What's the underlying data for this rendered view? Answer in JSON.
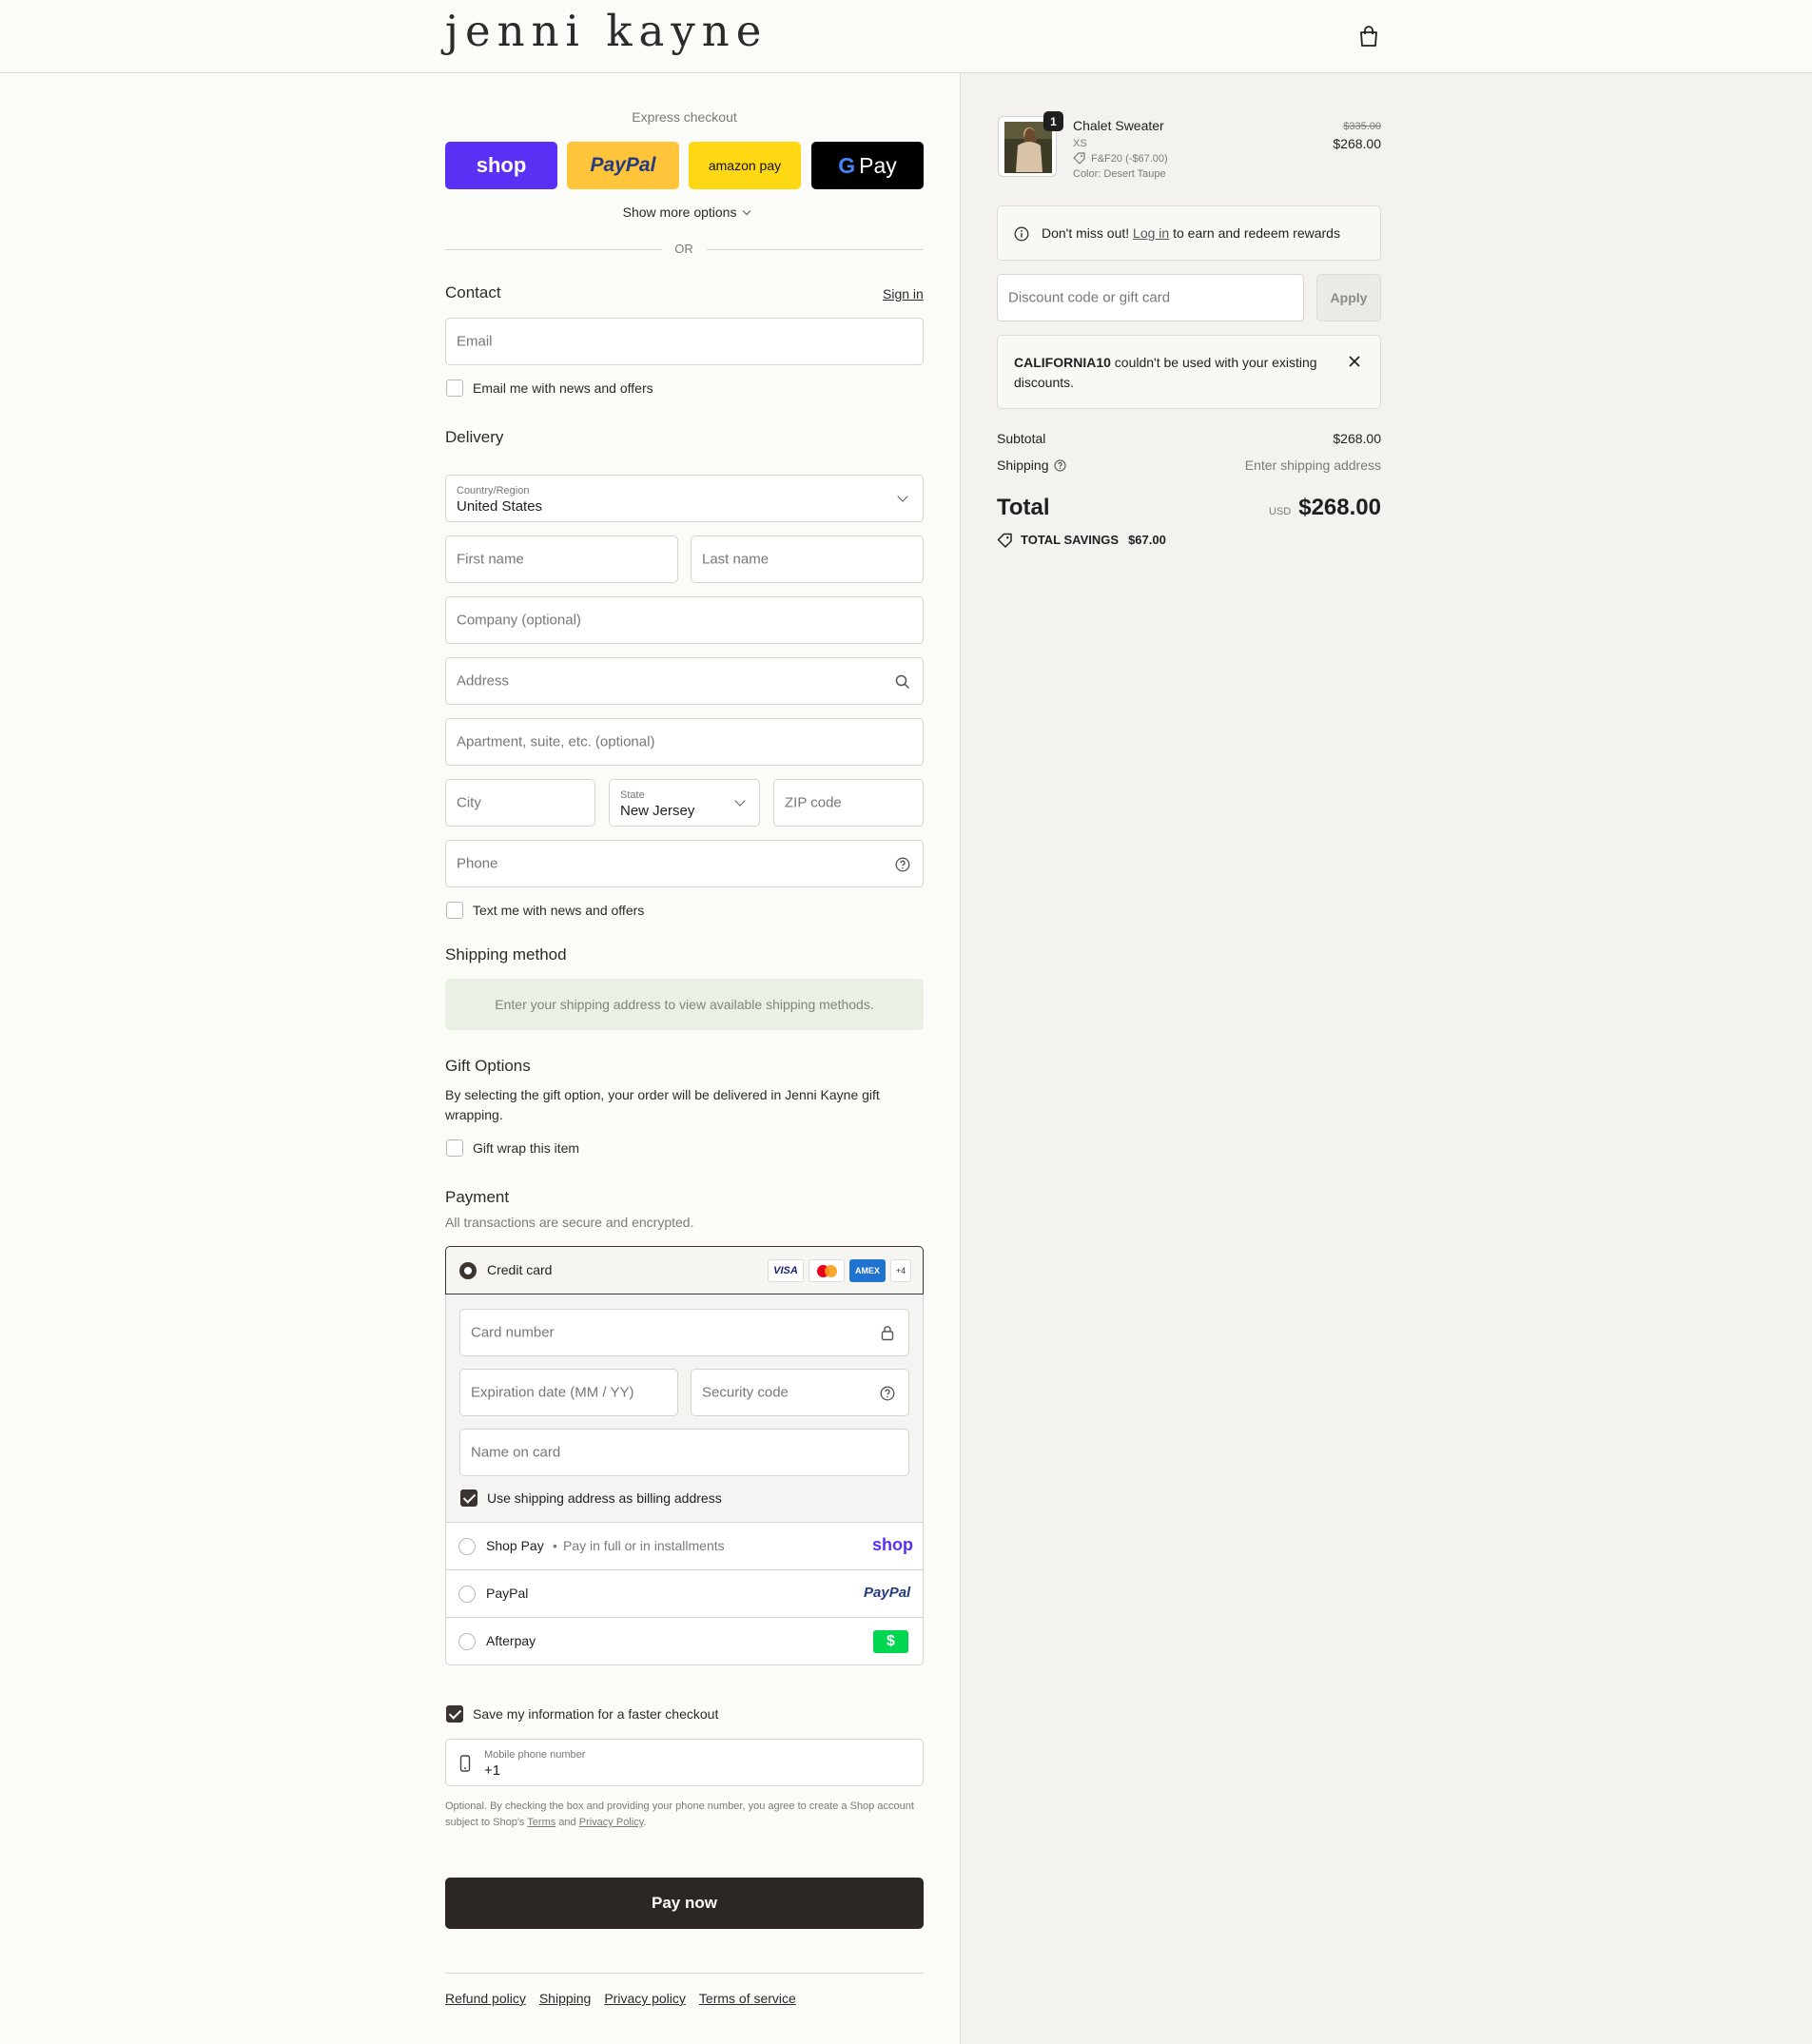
{
  "header": {
    "logo": "jenni kayne"
  },
  "express": {
    "title": "Express checkout",
    "shop_label": "shop",
    "paypal_label": "PayPal",
    "amazon_label": "amazon pay",
    "gpay_label": "Pay",
    "show_more": "Show more options",
    "or": "OR"
  },
  "contact": {
    "title": "Contact",
    "sign_in": "Sign in",
    "email_placeholder": "Email",
    "news_label": "Email me with news and offers"
  },
  "delivery": {
    "title": "Delivery",
    "country_label": "Country/Region",
    "country_value": "United States",
    "first_name": "First name",
    "last_name": "Last name",
    "company": "Company (optional)",
    "address": "Address",
    "apartment": "Apartment, suite, etc. (optional)",
    "city": "City",
    "state_label": "State",
    "state_value": "New Jersey",
    "zip": "ZIP code",
    "phone": "Phone",
    "text_label": "Text me with news and offers"
  },
  "shipping_method": {
    "title": "Shipping method",
    "message": "Enter your shipping address to view available shipping methods."
  },
  "gift": {
    "title": "Gift Options",
    "description": "By selecting the gift option, your order will be delivered in Jenni Kayne gift wrapping.",
    "wrap_label": "Gift wrap this item"
  },
  "payment": {
    "title": "Payment",
    "subtitle": "All transactions are secure and encrypted.",
    "credit_card": "Credit card",
    "card_brands": [
      "VISA",
      "AMEX",
      "+4"
    ],
    "card_number": "Card number",
    "expiration": "Expiration date (MM / YY)",
    "security": "Security code",
    "name_on_card": "Name on card",
    "billing_label": "Use shipping address as billing address",
    "shop_pay": "Shop Pay",
    "shop_pay_sub": "Pay in full or in installments",
    "shop_logo": "shop",
    "paypal": "PayPal",
    "paypal_logo": "PayPal",
    "afterpay": "Afterpay",
    "afterpay_logo": "$"
  },
  "save_info": {
    "label": "Save my information for a faster checkout",
    "mobile_label": "Mobile phone number",
    "mobile_value": "+1",
    "legal_1": "Optional. By checking the box and providing your phone number, you agree to create a Shop account",
    "legal_2a": "subject to Shop's",
    "legal_terms": "Terms",
    "legal_and": "and",
    "legal_privacy": "Privacy Policy",
    "legal_end": "."
  },
  "pay_now": "Pay now",
  "footer": [
    "Refund policy",
    "Shipping",
    "Privacy policy",
    "Terms of service"
  ],
  "summary": {
    "item": {
      "qty": "1",
      "name": "Chalet Sweater",
      "size": "XS",
      "discount": "F&F20 (-$67.00)",
      "color": "Color: Desert Taupe",
      "orig_price": "$335.00",
      "price": "$268.00"
    },
    "rewards_pre": "Don't miss out!",
    "rewards_link": "Log in",
    "rewards_post": "to earn and redeem rewards",
    "discount_placeholder": "Discount code or gift card",
    "apply": "Apply",
    "error_code": "CALIFORNIA10",
    "error_line1": "couldn't be used with your existing",
    "error_line2": "discounts.",
    "subtotal_label": "Subtotal",
    "subtotal_value": "$268.00",
    "shipping_label": "Shipping",
    "shipping_value": "Enter shipping address",
    "total_label": "Total",
    "currency": "USD",
    "total_value": "$268.00",
    "savings_label": "TOTAL SAVINGS",
    "savings_value": "$67.00"
  },
  "colors": {
    "shop": "#5a31f4",
    "paypal": "#ffc439",
    "amazon": "#ffd814",
    "gpay": "#000000",
    "accent": "#3a3330"
  }
}
